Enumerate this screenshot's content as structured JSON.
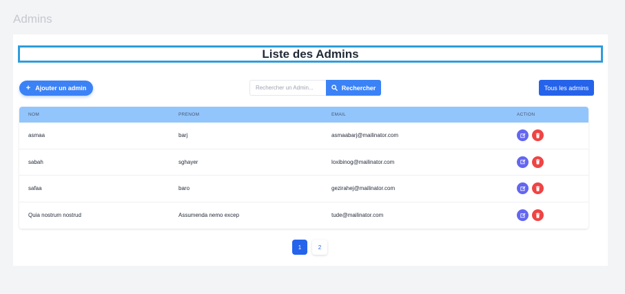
{
  "page": {
    "heading": "Admins"
  },
  "card": {
    "title": "Liste des Admins",
    "add_button_label": "Ajouter un admin",
    "search": {
      "placeholder": "Rechercher un Admin...",
      "value": "",
      "button_label": "Rechercher"
    },
    "all_button_label": "Tous les admins"
  },
  "table": {
    "headers": {
      "nom": "NOM",
      "prenom": "PRENOM",
      "email": "EMAIL",
      "action": "ACTION"
    },
    "rows": [
      {
        "nom": "asmaa",
        "prenom": "barj",
        "email": "asmaabarj@mailinator.com"
      },
      {
        "nom": "sabah",
        "prenom": "sghayer",
        "email": "loxibinog@mailinator.com"
      },
      {
        "nom": "safaa",
        "prenom": "baro",
        "email": "gezirahej@mailinator.com"
      },
      {
        "nom": "Quia nostrum nostrud",
        "prenom": "Assumenda nemo excep",
        "email": "tude@mailinator.com"
      }
    ]
  },
  "pagination": {
    "pages": [
      "1",
      "2"
    ],
    "current": "1"
  },
  "icons": {
    "add": "plus-icon",
    "search": "search-icon",
    "edit": "edit-icon",
    "delete": "trash-icon"
  },
  "colors": {
    "primary": "#3b82f6",
    "primary_dark": "#2563eb",
    "header_bg": "#93c5fd",
    "edit": "#6366f1",
    "delete": "#ef4444",
    "title_border": "#2d9cdb"
  }
}
